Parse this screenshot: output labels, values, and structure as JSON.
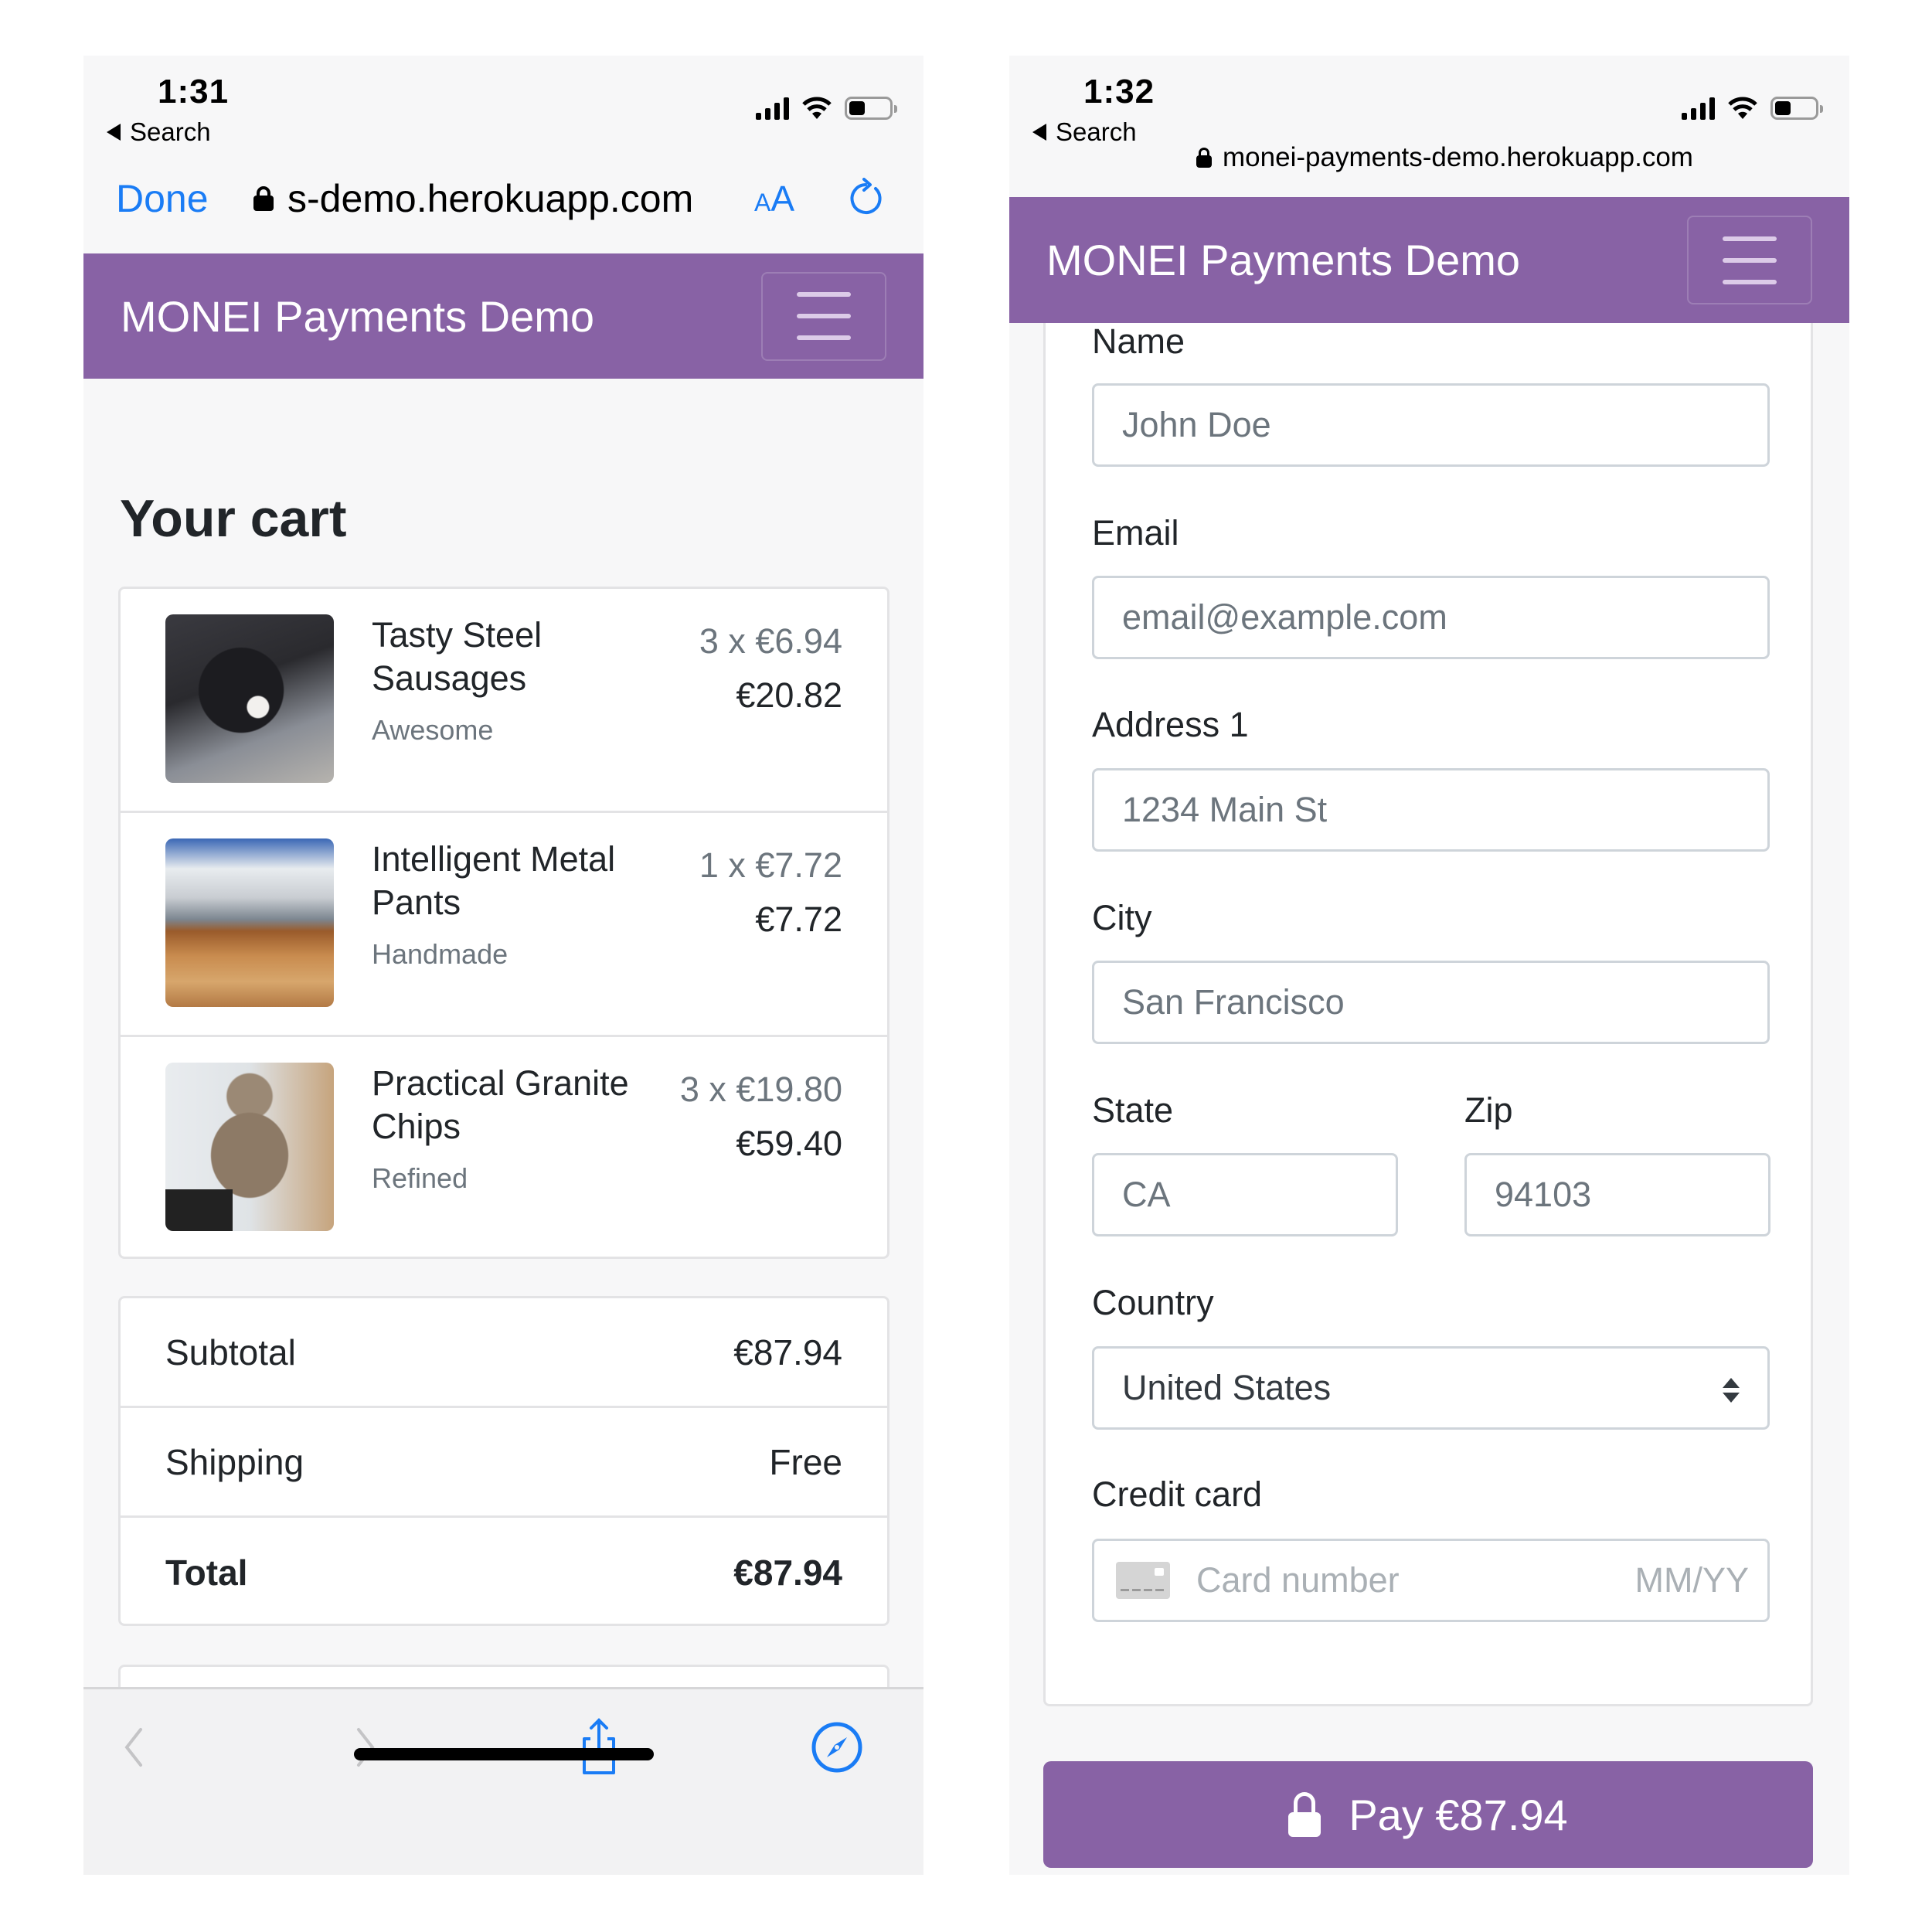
{
  "left_screen": {
    "status": {
      "time": "1:31",
      "back_label": "Search"
    },
    "browser": {
      "done_label": "Done",
      "url": "s-demo.herokuapp.com",
      "text_size_label_small": "A",
      "text_size_label_large": "A"
    },
    "navbar": {
      "brand": "MONEI Payments Demo"
    },
    "cart": {
      "title": "Your cart",
      "items": [
        {
          "name": "Tasty Steel Sausages",
          "description": "Awesome",
          "quantity_price": "3 x €6.94",
          "line_total": "€20.82",
          "image": "puppy"
        },
        {
          "name": "Intelligent Metal Pants",
          "description": "Handmade",
          "quantity_price": "1 x €7.72",
          "line_total": "€7.72",
          "image": "landscape"
        },
        {
          "name": "Practical Granite Chips",
          "description": "Refined",
          "quantity_price": "3 x €19.80",
          "line_total": "€59.40",
          "image": "cat"
        }
      ],
      "summary": [
        {
          "label": "Subtotal",
          "value": "€87.94"
        },
        {
          "label": "Shipping",
          "value": "Free"
        },
        {
          "label": "Total",
          "value": "€87.94"
        }
      ]
    },
    "toolbar": {
      "icons": [
        "back-arrow",
        "forward-arrow",
        "share",
        "safari-compass"
      ]
    }
  },
  "right_screen": {
    "status": {
      "time": "1:32",
      "back_label": "Search"
    },
    "browser": {
      "url": "monei-payments-demo.herokuapp.com"
    },
    "navbar": {
      "brand": "MONEI Payments Demo"
    },
    "form": {
      "name": {
        "label": "Name",
        "placeholder": "John Doe"
      },
      "email": {
        "label": "Email",
        "placeholder": "email@example.com"
      },
      "address1": {
        "label": "Address 1",
        "placeholder": "1234 Main St"
      },
      "city": {
        "label": "City",
        "placeholder": "San Francisco"
      },
      "state": {
        "label": "State",
        "placeholder": "CA"
      },
      "zip": {
        "label": "Zip",
        "placeholder": "94103"
      },
      "country": {
        "label": "Country",
        "selected": "United States"
      },
      "credit_card": {
        "label": "Credit card",
        "number_placeholder": "Card number",
        "expiry_placeholder": "MM/YY"
      }
    },
    "pay_button": {
      "label": "Pay €87.94"
    }
  },
  "colors": {
    "brand_purple": "#8862a5",
    "ios_blue": "#1a7cf5",
    "muted_text": "#6c757d"
  }
}
